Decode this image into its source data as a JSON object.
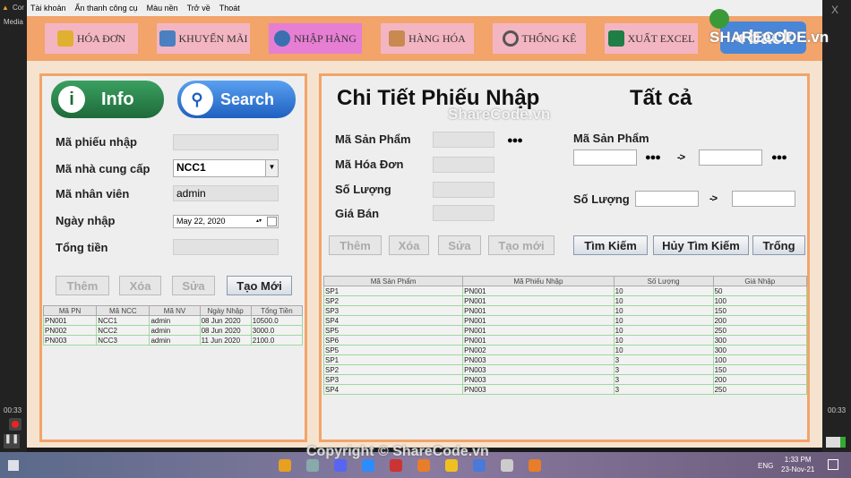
{
  "window": {
    "title_fragment": "Cor",
    "media_label": "Media",
    "close": "X",
    "time_left": "00:33",
    "time_right": "00:33"
  },
  "menu": [
    "Tài khoản",
    "Ẩn thanh công cụ",
    "Màu nền",
    "Trở về",
    "Thoát"
  ],
  "toolbar": [
    {
      "label": "HÓA ĐƠN",
      "icon": "invoice-icon",
      "color": "#e0b030"
    },
    {
      "label": "KHUYẾN MÃI",
      "icon": "coupon-icon",
      "color": "#4a80c0"
    },
    {
      "label": "NHẬP HÀNG",
      "icon": "globe-import-icon",
      "color": "#3a70b0",
      "active": true
    },
    {
      "label": "HÀNG HÓA",
      "icon": "boxes-icon",
      "color": "#c88a50"
    },
    {
      "label": "THỐNG KÊ",
      "icon": "magnifier-chart-icon",
      "color": "#555"
    },
    {
      "label": "XUẤT EXCEL",
      "icon": "excel-icon",
      "color": "#1e7e45"
    }
  ],
  "back_label": "◂ back",
  "left": {
    "info_label": "Info",
    "search_label": "Search",
    "fields": [
      {
        "label": "Mã phiếu nhập",
        "value": ""
      },
      {
        "label": "Mã nhà cung cấp",
        "value": "NCC1"
      },
      {
        "label": "Mã nhân viên",
        "value": "admin"
      },
      {
        "label": "Ngày nhập",
        "value": "May 22, 2020"
      },
      {
        "label": "Tổng tiền",
        "value": ""
      }
    ],
    "buttons": [
      "Thêm",
      "Xóa",
      "Sửa",
      "Tạo Mới"
    ],
    "table": {
      "headers": [
        "Mã PN",
        "Mã NCC",
        "Mã NV",
        "Ngày Nhập",
        "Tổng Tiền"
      ],
      "rows": [
        [
          "PN001",
          "NCC1",
          "admin",
          "08 Jun 2020",
          "10500.0"
        ],
        [
          "PN002",
          "NCC2",
          "admin",
          "08 Jun 2020",
          "3000.0"
        ],
        [
          "PN003",
          "NCC3",
          "admin",
          "11 Jun 2020",
          "2100.0"
        ]
      ]
    }
  },
  "right": {
    "title": "Chi Tiết Phiếu Nhập",
    "filter_title": "Tất cả",
    "fields": [
      "Mã Sản Phẩm",
      "Mã Hóa Đơn",
      "Số Lượng",
      "Giá Bán"
    ],
    "dots": "●●●",
    "arrow": "->",
    "search_product_label": "Mã Sản Phẩm",
    "search_qty_label": "Số Lượng",
    "buttons": [
      "Thêm",
      "Xóa",
      "Sửa",
      "Tạo mới"
    ],
    "search_buttons": [
      "Tìm Kiếm",
      "Hủy Tìm Kiếm",
      "Trống"
    ],
    "table": {
      "headers": [
        "Mã Sản Phẩm",
        "Mã Phiếu Nhập",
        "Số Lượng",
        "Giá Nhập"
      ],
      "rows": [
        [
          "SP1",
          "PN001",
          "10",
          "50"
        ],
        [
          "SP2",
          "PN001",
          "10",
          "100"
        ],
        [
          "SP3",
          "PN001",
          "10",
          "150"
        ],
        [
          "SP4",
          "PN001",
          "10",
          "200"
        ],
        [
          "SP5",
          "PN001",
          "10",
          "250"
        ],
        [
          "SP6",
          "PN001",
          "10",
          "300"
        ],
        [
          "SP5",
          "PN002",
          "10",
          "300"
        ],
        [
          "SP1",
          "PN003",
          "3",
          "100"
        ],
        [
          "SP2",
          "PN003",
          "3",
          "150"
        ],
        [
          "SP3",
          "PN003",
          "3",
          "200"
        ],
        [
          "SP4",
          "PN003",
          "3",
          "250"
        ]
      ]
    }
  },
  "watermarks": {
    "logo": "SHARECODE.vn",
    "center": "ShareCode.vn",
    "copyright": "Copyright © ShareCode.vn"
  },
  "taskbar": {
    "lang": "ENG",
    "time": "1:33 PM",
    "date": "23-Nov-21"
  }
}
